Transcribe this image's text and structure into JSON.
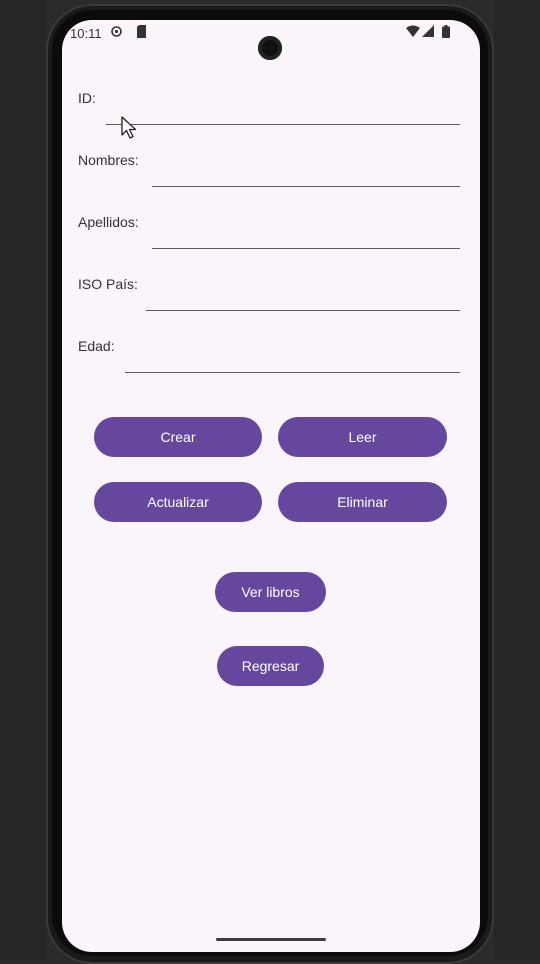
{
  "status_bar": {
    "time": "10:11",
    "icons": [
      "settings-icon",
      "sd-card-icon",
      "wifi-icon",
      "signal-icon",
      "battery-icon"
    ]
  },
  "form": {
    "fields": [
      {
        "label": "ID:",
        "value": ""
      },
      {
        "label": "Nombres:",
        "value": ""
      },
      {
        "label": "Apellidos:",
        "value": ""
      },
      {
        "label": "ISO País:",
        "value": ""
      },
      {
        "label": "Edad:",
        "value": ""
      }
    ]
  },
  "buttons": {
    "crear": "Crear",
    "leer": "Leer",
    "actualizar": "Actualizar",
    "eliminar": "Eliminar",
    "ver_libros": "Ver libros",
    "regresar": "Regresar"
  },
  "colors": {
    "button": "#65479e",
    "screen_bg": "#fcf4fb"
  }
}
